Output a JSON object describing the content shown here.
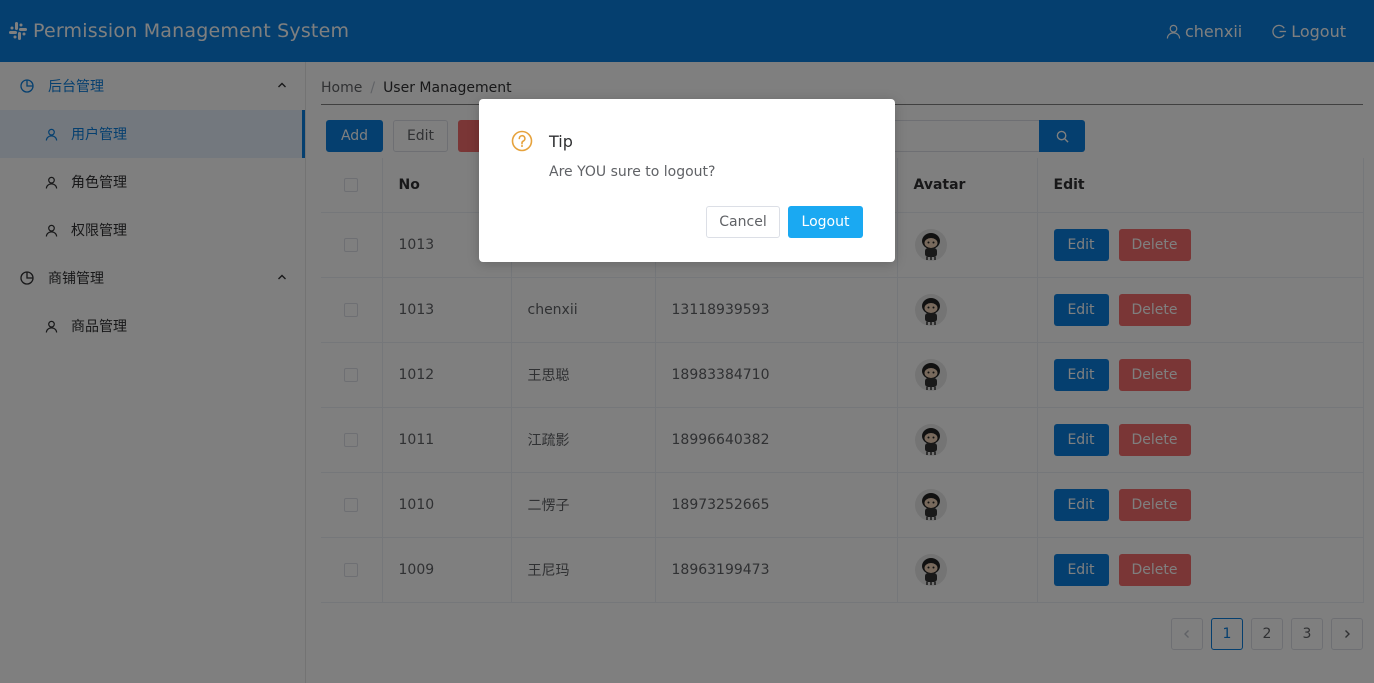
{
  "header": {
    "title": "Permission Management System",
    "username": "chenxii",
    "logout_label": "Logout",
    "bg_color": "#0a7fde"
  },
  "sidebar": {
    "groups": [
      {
        "label": "后台管理",
        "icon": "pie-chart-icon",
        "expanded": true,
        "items": [
          {
            "label": "用户管理",
            "icon": "user-icon",
            "active": true
          },
          {
            "label": "角色管理",
            "icon": "user-icon",
            "active": false
          },
          {
            "label": "权限管理",
            "icon": "user-icon",
            "active": false
          }
        ]
      },
      {
        "label": "商铺管理",
        "icon": "pie-chart-icon",
        "expanded": true,
        "items": [
          {
            "label": "商品管理",
            "icon": "user-icon",
            "active": false
          }
        ]
      }
    ]
  },
  "breadcrumb": {
    "home": "Home",
    "current": "User Management"
  },
  "toolbar": {
    "add_label": "Add",
    "edit_label": "Edit",
    "delete_label": "D"
  },
  "table": {
    "headers": {
      "no": "No",
      "avatar": "Avatar",
      "edit": "Edit"
    },
    "rows": [
      {
        "no": "1013",
        "name": "",
        "phone": ""
      },
      {
        "no": "1013",
        "name": "chenxii",
        "phone": "13118939593"
      },
      {
        "no": "1012",
        "name": "王思聪",
        "phone": "18983384710"
      },
      {
        "no": "1011",
        "name": "江疏影",
        "phone": "18996640382"
      },
      {
        "no": "1010",
        "name": "二愣子",
        "phone": "18973252665"
      },
      {
        "no": "1009",
        "name": "王尼玛",
        "phone": "18963199473"
      }
    ],
    "row_edit_label": "Edit",
    "row_delete_label": "Delete"
  },
  "pagination": {
    "pages": [
      "1",
      "2",
      "3"
    ],
    "current": "1"
  },
  "dialog": {
    "title": "Tip",
    "message": "Are YOU sure to logout?",
    "cancel_label": "Cancel",
    "confirm_label": "Logout",
    "icon": "question-circle-icon",
    "warning_color": "#e6a23c"
  }
}
